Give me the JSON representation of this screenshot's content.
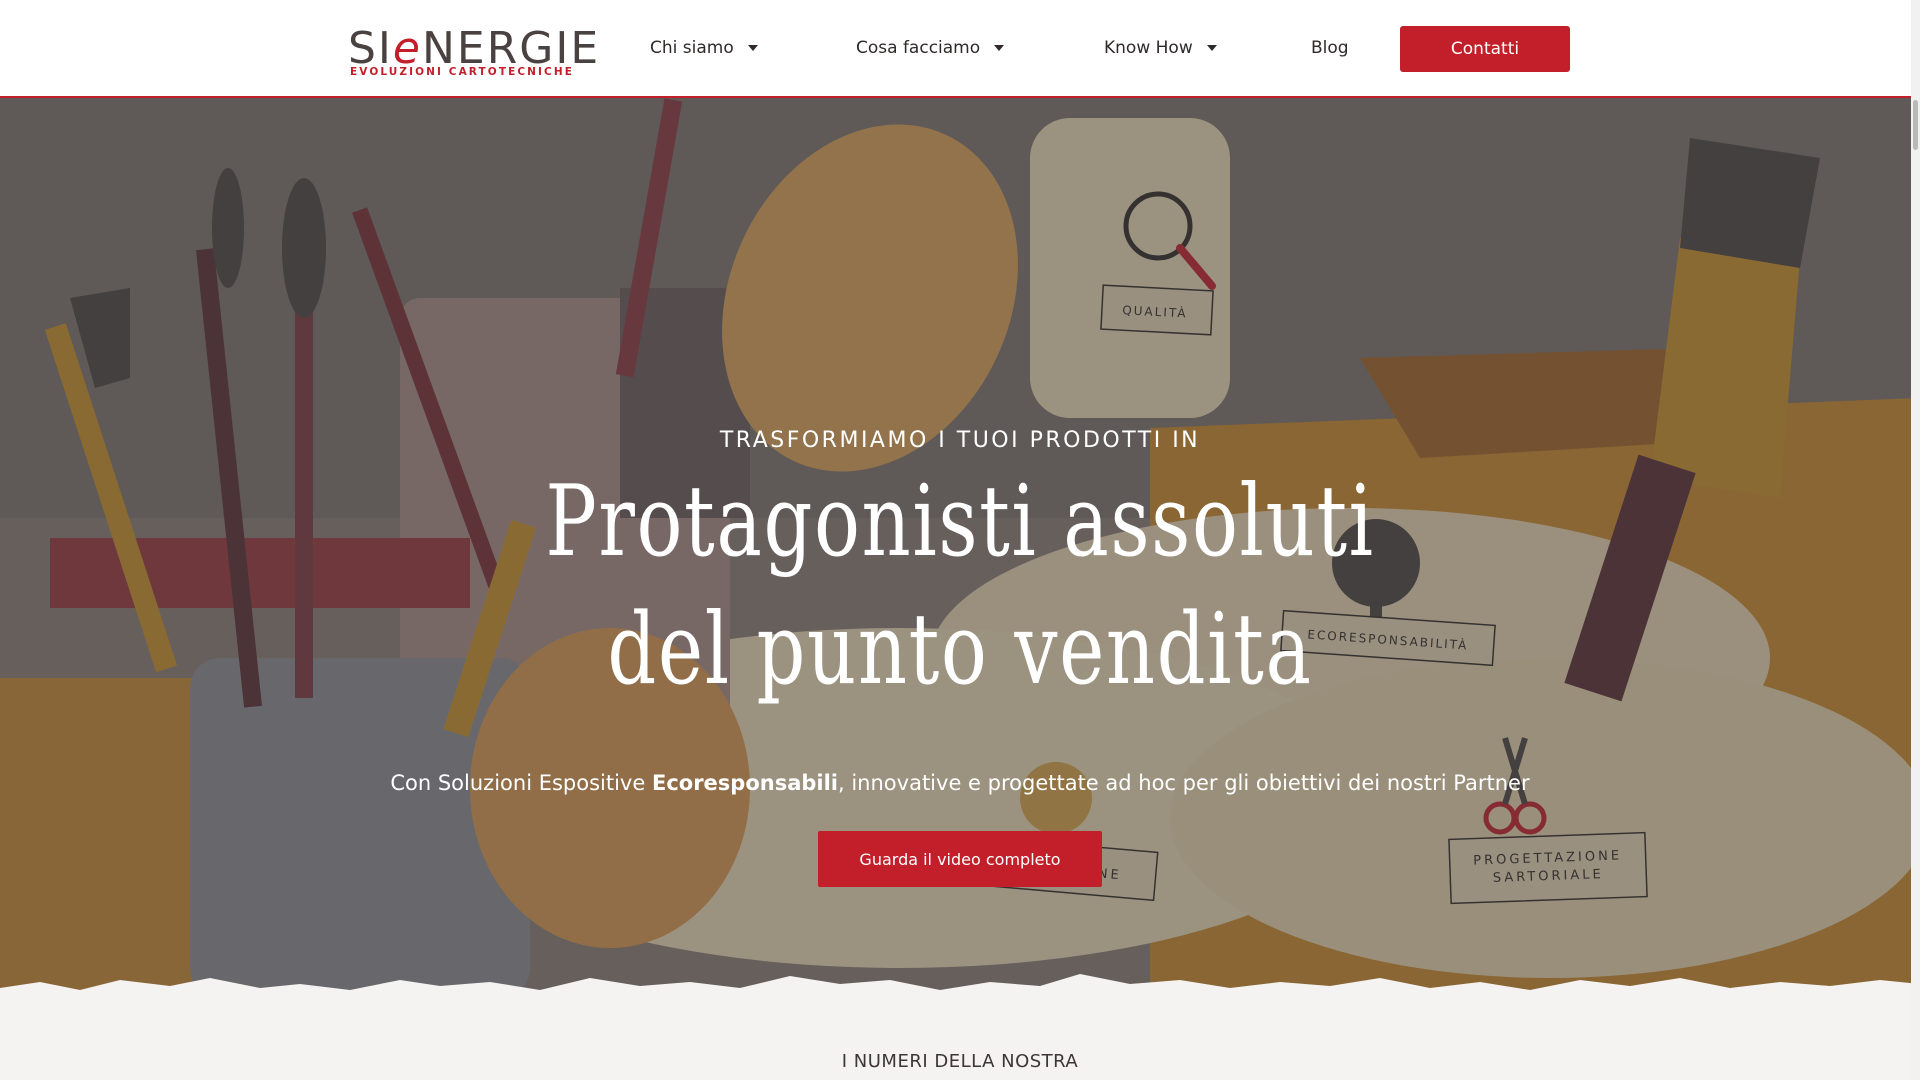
{
  "logo": {
    "brand_pre": "SI",
    "brand_e": "e",
    "brand_post": "NERGIE",
    "tagline": "EVOLUZIONI CARTOTECNICHE"
  },
  "nav": {
    "items": [
      {
        "label": "Chi siamo",
        "has_dropdown": true
      },
      {
        "label": "Cosa facciamo",
        "has_dropdown": true
      },
      {
        "label": "Know How",
        "has_dropdown": true
      },
      {
        "label": "Blog",
        "has_dropdown": false
      }
    ],
    "cta_label": "Contatti"
  },
  "hero": {
    "kicker": "TRASFORMIAMO I TUOI PRODOTTI IN",
    "title_line1": "Protagonisti assoluti",
    "title_line2": "del punto vendita",
    "subtitle_pre": "Con Soluzioni Espositive ",
    "subtitle_bold": "Ecoresponsabili",
    "subtitle_post": ", innovative e progettate ad hoc per gli obiettivi dei nostri Partner",
    "button_label": "Guarda il video completo",
    "illustration_tags": [
      "QUALITÀ",
      "ECORESPONSABILITÀ",
      "INNOVAZIONE",
      "PROGETTAZIONE",
      "SARTORIALE"
    ]
  },
  "numbers": {
    "title": "I NUMERI DELLA NOSTRA"
  },
  "colors": {
    "brand_red": "#c21f2a",
    "text_dark": "#2f2a29",
    "hero_overlay": "#4a4646"
  }
}
